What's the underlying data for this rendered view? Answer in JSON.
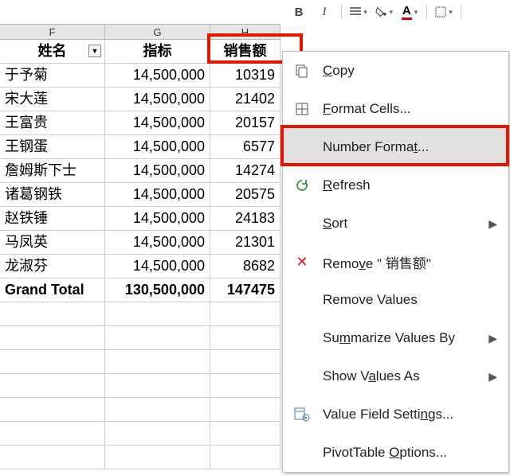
{
  "columns": {
    "F": "F",
    "G": "G",
    "H": "H"
  },
  "headers": {
    "name": "姓名",
    "target": "指标",
    "sales": "销售额"
  },
  "rows": [
    {
      "name": "于予菊",
      "target": "14,500,000",
      "amt": "10319"
    },
    {
      "name": "宋大莲",
      "target": "14,500,000",
      "amt": "21402"
    },
    {
      "name": "王富贵",
      "target": "14,500,000",
      "amt": "20157"
    },
    {
      "name": "王钢蛋",
      "target": "14,500,000",
      "amt": "6577"
    },
    {
      "name": "詹姆斯下士",
      "target": "14,500,000",
      "amt": "14274"
    },
    {
      "name": "诸葛钢铁",
      "target": "14,500,000",
      "amt": "20575"
    },
    {
      "name": "赵铁锤",
      "target": "14,500,000",
      "amt": "24183"
    },
    {
      "name": "马凤英",
      "target": "14,500,000",
      "amt": "21301"
    },
    {
      "name": "龙淑芬",
      "target": "14,500,000",
      "amt": "8682"
    }
  ],
  "grand_total": {
    "label": "Grand Total",
    "target": "130,500,000",
    "amt": "147475"
  },
  "menu": {
    "copy": "Copy",
    "format_cells": "Format Cells...",
    "number_format": "Number Format...",
    "refresh": "Refresh",
    "sort": "Sort",
    "remove_field": "Remove \" 销售额\"",
    "remove_values": "Remove Values",
    "summarize": "Summarize Values By",
    "show_as": "Show Values As",
    "vfs": "Value Field Settings...",
    "pto": "PivotTable Options..."
  }
}
